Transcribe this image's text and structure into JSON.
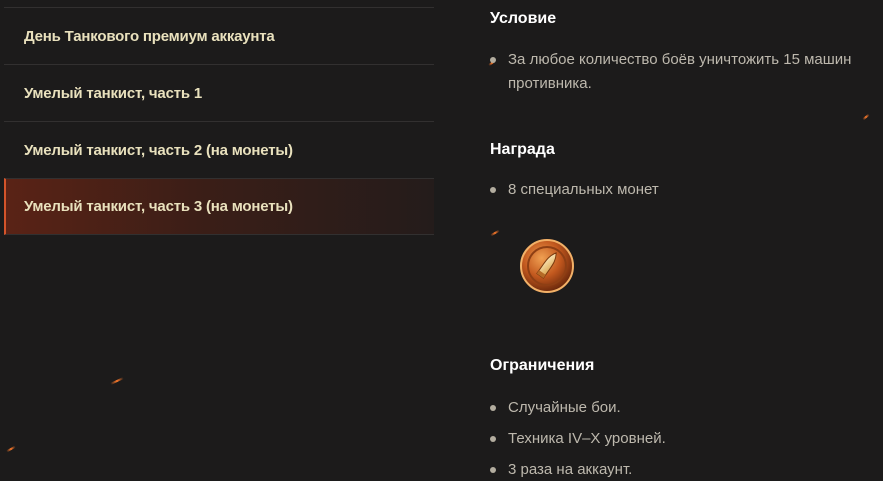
{
  "missions": [
    {
      "label": "День Танкового премиум аккаунта",
      "active": false
    },
    {
      "label": "Умелый танкист, часть 1",
      "active": false
    },
    {
      "label": "Умелый танкист, часть 2 (на монеты)",
      "active": false
    },
    {
      "label": "Умелый танкист, часть 3 (на монеты)",
      "active": true
    }
  ],
  "details": {
    "condition": {
      "title": "Условие",
      "items": [
        "За любое количество боёв уничтожить 15 машин противника."
      ]
    },
    "reward": {
      "title": "Награда",
      "items": [
        "8 специальных монет"
      ],
      "icon": "bullet-coin-icon"
    },
    "restrictions": {
      "title": "Ограничения",
      "items": [
        "Случайные бои.",
        "Техника IV–X уровней.",
        "3 раза на аккаунт."
      ]
    }
  },
  "colors": {
    "background": "#1c1b1b",
    "active_accent": "#d4542a",
    "mission_text": "#e9e1bd",
    "body_text": "#bdb8ad"
  }
}
